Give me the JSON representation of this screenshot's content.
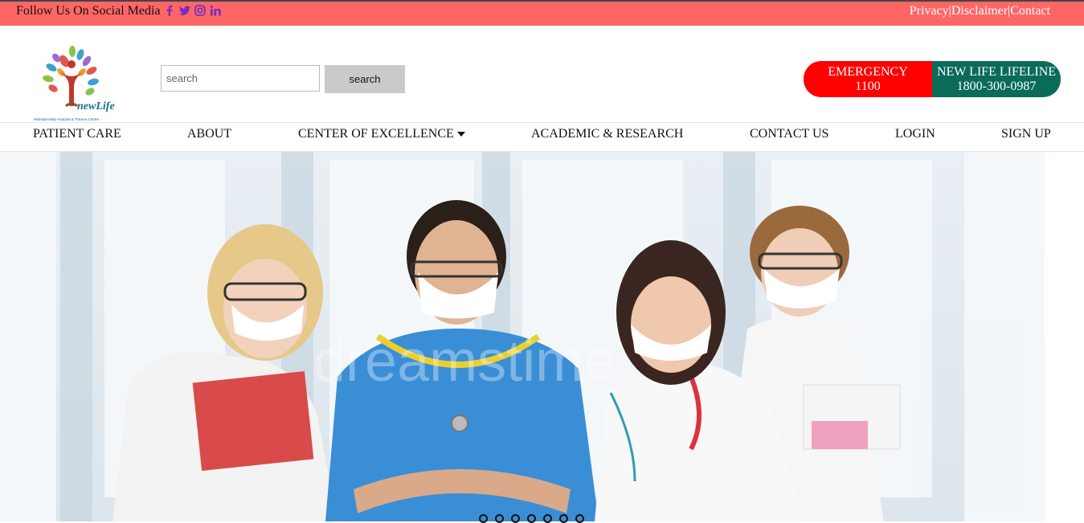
{
  "topbar": {
    "follow_text": "Follow Us On Social Media",
    "social_icons": [
      "facebook-icon",
      "twitter-icon",
      "instagram-icon",
      "linkedin-icon"
    ],
    "social_color": "#7b2fbf",
    "links": [
      "Privacy",
      "Disclaimer",
      "Contact"
    ],
    "bg_color": "#ff6666"
  },
  "header": {
    "logo_text": "newLife",
    "logo_subtext": "Multispeciality Hospital & Trauma Centre",
    "search": {
      "placeholder": "search",
      "button_label": "search"
    },
    "emergency": {
      "label": "EMERGENCY",
      "number": "1100",
      "color": "#ff0000"
    },
    "lifeline": {
      "label": "NEW LIFE LIFELINE",
      "number": "1800-300-0987",
      "color": "#0b6b59"
    }
  },
  "nav": {
    "items": [
      "PATIENT CARE",
      "ABOUT",
      "CENTER OF EXCELLENCE",
      "ACADEMIC & RESEARCH",
      "CONTACT US",
      "LOGIN",
      "SIGN UP"
    ]
  },
  "hero": {
    "image": "medical team of four doctors in masks",
    "watermark": "dreamstime",
    "slide_count": 7
  }
}
